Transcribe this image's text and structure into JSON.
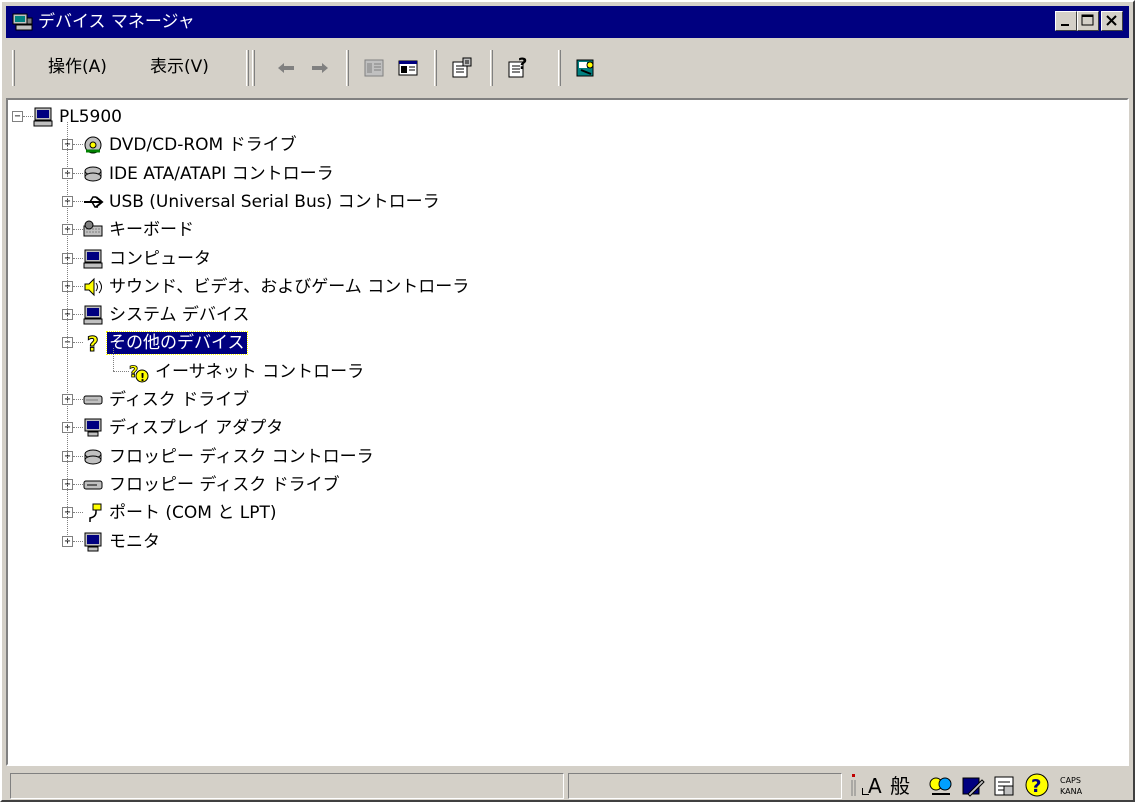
{
  "window": {
    "title": "デバイス マネージャ",
    "controls": {
      "minimize": "_",
      "maximize": "□",
      "close": "×"
    }
  },
  "menu": {
    "action": "操作(A)",
    "view": "表示(V)"
  },
  "toolbar": {
    "icons": [
      "back-arrow-icon",
      "forward-arrow-icon",
      "tree-view-icon",
      "show-hide-icon",
      "properties-icon",
      "help-icon",
      "scan-hardware-icon"
    ]
  },
  "tree": {
    "root": "PL5900",
    "items": [
      {
        "label": "DVD/CD-ROM ドライブ",
        "icon": "cdrom-icon"
      },
      {
        "label": "IDE ATA/ATAPI コントローラ",
        "icon": "ide-controller-icon"
      },
      {
        "label": "USB (Universal Serial Bus) コントローラ",
        "icon": "usb-icon"
      },
      {
        "label": "キーボード",
        "icon": "keyboard-icon"
      },
      {
        "label": "コンピュータ",
        "icon": "computer-icon"
      },
      {
        "label": "サウンド、ビデオ、およびゲーム コントローラ",
        "icon": "sound-icon"
      },
      {
        "label": "システム デバイス",
        "icon": "system-device-icon"
      },
      {
        "label": "その他のデバイス",
        "icon": "unknown-device-icon",
        "selected": true,
        "children": [
          {
            "label": "イーサネット コントローラ",
            "icon": "warning-device-icon"
          }
        ]
      },
      {
        "label": "ディスク ドライブ",
        "icon": "disk-drive-icon"
      },
      {
        "label": "ディスプレイ アダプタ",
        "icon": "display-adapter-icon"
      },
      {
        "label": "フロッピー ディスク コントローラ",
        "icon": "floppy-controller-icon"
      },
      {
        "label": "フロッピー ディスク ドライブ",
        "icon": "floppy-drive-icon"
      },
      {
        "label": "ポート (COM と LPT)",
        "icon": "port-icon"
      },
      {
        "label": "モニタ",
        "icon": "monitor-icon"
      }
    ]
  },
  "statusbar": {
    "ime_mode": "A",
    "ime_kanji": "般",
    "caps": "CAPS",
    "kana": "KANA"
  },
  "colors": {
    "titlebar": "#000080",
    "face": "#d4d0c8",
    "selection": "#000080"
  }
}
